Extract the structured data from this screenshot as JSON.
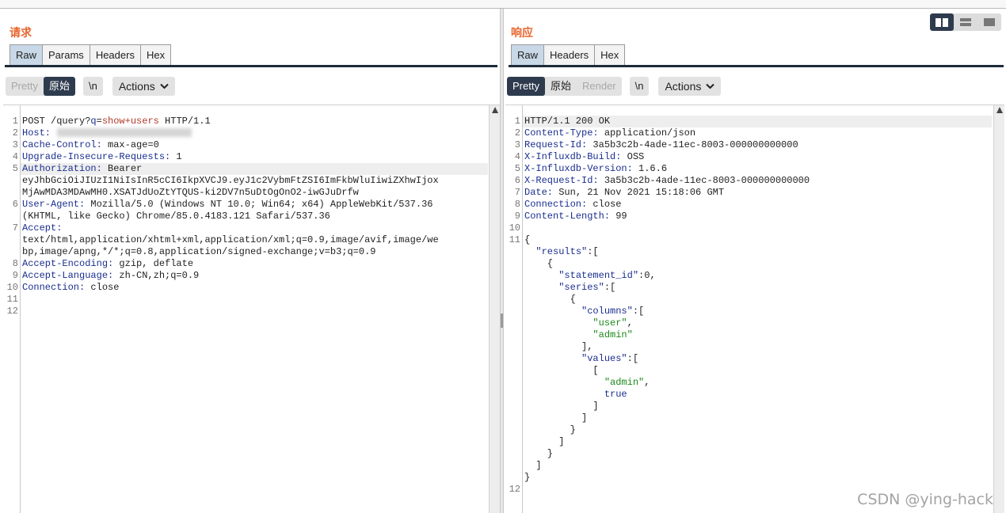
{
  "request": {
    "title": "请求",
    "tabs": [
      "Raw",
      "Params",
      "Headers",
      "Hex"
    ],
    "active_tab": "Raw",
    "toolbar": {
      "pretty": "Pretty",
      "raw": "原始",
      "newline": "\\n",
      "actions": "Actions"
    },
    "lines": [
      {
        "n": "1",
        "parts": [
          {
            "t": "POST /query?",
            "c": "v"
          },
          {
            "t": "q",
            "c": "k"
          },
          {
            "t": "=",
            "c": "v"
          },
          {
            "t": "show+users",
            "c": "q"
          },
          {
            "t": " HTTP/1.1",
            "c": "v"
          }
        ]
      },
      {
        "n": "2",
        "parts": [
          {
            "t": "Host:",
            "c": "k"
          }
        ]
      },
      {
        "n": "3",
        "parts": [
          {
            "t": "Cache-Control:",
            "c": "k"
          },
          {
            "t": " max-age=0",
            "c": "v"
          }
        ]
      },
      {
        "n": "4",
        "parts": [
          {
            "t": "Upgrade-Insecure-Requests:",
            "c": "k"
          },
          {
            "t": " 1",
            "c": "v"
          }
        ]
      },
      {
        "n": "5",
        "parts": [
          {
            "t": "Authorization:",
            "c": "k"
          },
          {
            "t": " Bearer",
            "c": "v"
          }
        ]
      },
      {
        "n": "",
        "parts": [
          {
            "t": "eyJhbGciOiJIUzI1NiIsInR5cCI6IkpXVCJ9.eyJ1c2VybmFtZSI6ImFkbWluIiwiZXhwIjox",
            "c": "v"
          }
        ]
      },
      {
        "n": "",
        "parts": [
          {
            "t": "MjAwMDA3MDAwMH0.XSATJdUoZtYTQUS-ki2DV7n5uDtOgOnO2-iwGJuDrfw",
            "c": "v"
          }
        ]
      },
      {
        "n": "6",
        "parts": [
          {
            "t": "User-Agent:",
            "c": "k"
          },
          {
            "t": " Mozilla/5.0 (Windows NT 10.0; Win64; x64) AppleWebKit/537.36",
            "c": "v"
          }
        ]
      },
      {
        "n": "",
        "parts": [
          {
            "t": "(KHTML, like Gecko) Chrome/85.0.4183.121 Safari/537.36",
            "c": "v"
          }
        ]
      },
      {
        "n": "7",
        "parts": [
          {
            "t": "Accept:",
            "c": "k"
          }
        ]
      },
      {
        "n": "",
        "parts": [
          {
            "t": "text/html,application/xhtml+xml,application/xml;q=0.9,image/avif,image/we",
            "c": "v"
          }
        ]
      },
      {
        "n": "",
        "parts": [
          {
            "t": "bp,image/apng,*/*;q=0.8,application/signed-exchange;v=b3;q=0.9",
            "c": "v"
          }
        ]
      },
      {
        "n": "8",
        "parts": [
          {
            "t": "Accept-Encoding:",
            "c": "k"
          },
          {
            "t": " gzip, deflate",
            "c": "v"
          }
        ]
      },
      {
        "n": "9",
        "parts": [
          {
            "t": "Accept-Language:",
            "c": "k"
          },
          {
            "t": " zh-CN,zh;q=0.9",
            "c": "v"
          }
        ]
      },
      {
        "n": "10",
        "parts": [
          {
            "t": "Connection:",
            "c": "k"
          },
          {
            "t": " close",
            "c": "v"
          }
        ]
      },
      {
        "n": "11",
        "parts": []
      },
      {
        "n": "12",
        "parts": []
      }
    ]
  },
  "response": {
    "title": "响应",
    "tabs": [
      "Raw",
      "Headers",
      "Hex"
    ],
    "active_tab": "Raw",
    "toolbar": {
      "pretty": "Pretty",
      "raw": "原始",
      "render": "Render",
      "newline": "\\n",
      "actions": "Actions"
    },
    "lines": [
      {
        "n": "1",
        "parts": [
          {
            "t": "HTTP/1.1 200 OK",
            "c": "v"
          }
        ]
      },
      {
        "n": "2",
        "parts": [
          {
            "t": "Content-Type:",
            "c": "k"
          },
          {
            "t": " application/json",
            "c": "v"
          }
        ]
      },
      {
        "n": "3",
        "parts": [
          {
            "t": "Request-Id:",
            "c": "k"
          },
          {
            "t": " 3a5b3c2b-4ade-11ec-8003-000000000000",
            "c": "v"
          }
        ]
      },
      {
        "n": "4",
        "parts": [
          {
            "t": "X-Influxdb-Build:",
            "c": "k"
          },
          {
            "t": " OSS",
            "c": "v"
          }
        ]
      },
      {
        "n": "5",
        "parts": [
          {
            "t": "X-Influxdb-Version:",
            "c": "k"
          },
          {
            "t": " 1.6.6",
            "c": "v"
          }
        ]
      },
      {
        "n": "6",
        "parts": [
          {
            "t": "X-Request-Id:",
            "c": "k"
          },
          {
            "t": " 3a5b3c2b-4ade-11ec-8003-000000000000",
            "c": "v"
          }
        ]
      },
      {
        "n": "7",
        "parts": [
          {
            "t": "Date:",
            "c": "k"
          },
          {
            "t": " Sun, 21 Nov 2021 15:18:06 GMT",
            "c": "v"
          }
        ]
      },
      {
        "n": "8",
        "parts": [
          {
            "t": "Connection:",
            "c": "k"
          },
          {
            "t": " close",
            "c": "v"
          }
        ]
      },
      {
        "n": "9",
        "parts": [
          {
            "t": "Content-Length:",
            "c": "k"
          },
          {
            "t": " 99",
            "c": "v"
          }
        ]
      },
      {
        "n": "10",
        "parts": []
      },
      {
        "n": "11",
        "parts": [
          {
            "t": "{",
            "c": "v"
          }
        ]
      },
      {
        "n": "",
        "parts": [
          {
            "t": "  ",
            "c": "v"
          },
          {
            "t": "\"results\"",
            "c": "k"
          },
          {
            "t": ":[",
            "c": "v"
          }
        ]
      },
      {
        "n": "",
        "parts": [
          {
            "t": "    {",
            "c": "v"
          }
        ]
      },
      {
        "n": "",
        "parts": [
          {
            "t": "      ",
            "c": "v"
          },
          {
            "t": "\"statement_id\"",
            "c": "k"
          },
          {
            "t": ":0,",
            "c": "v"
          }
        ]
      },
      {
        "n": "",
        "parts": [
          {
            "t": "      ",
            "c": "v"
          },
          {
            "t": "\"series\"",
            "c": "k"
          },
          {
            "t": ":[",
            "c": "v"
          }
        ]
      },
      {
        "n": "",
        "parts": [
          {
            "t": "        {",
            "c": "v"
          }
        ]
      },
      {
        "n": "",
        "parts": [
          {
            "t": "          ",
            "c": "v"
          },
          {
            "t": "\"columns\"",
            "c": "k"
          },
          {
            "t": ":[",
            "c": "v"
          }
        ]
      },
      {
        "n": "",
        "parts": [
          {
            "t": "            ",
            "c": "v"
          },
          {
            "t": "\"user\"",
            "c": "str"
          },
          {
            "t": ",",
            "c": "v"
          }
        ]
      },
      {
        "n": "",
        "parts": [
          {
            "t": "            ",
            "c": "v"
          },
          {
            "t": "\"admin\"",
            "c": "str"
          }
        ]
      },
      {
        "n": "",
        "parts": [
          {
            "t": "          ],",
            "c": "v"
          }
        ]
      },
      {
        "n": "",
        "parts": [
          {
            "t": "          ",
            "c": "v"
          },
          {
            "t": "\"values\"",
            "c": "k"
          },
          {
            "t": ":[",
            "c": "v"
          }
        ]
      },
      {
        "n": "",
        "parts": [
          {
            "t": "            [",
            "c": "v"
          }
        ]
      },
      {
        "n": "",
        "parts": [
          {
            "t": "              ",
            "c": "v"
          },
          {
            "t": "\"admin\"",
            "c": "str"
          },
          {
            "t": ",",
            "c": "v"
          }
        ]
      },
      {
        "n": "",
        "parts": [
          {
            "t": "              ",
            "c": "v"
          },
          {
            "t": "true",
            "c": "k"
          }
        ]
      },
      {
        "n": "",
        "parts": [
          {
            "t": "            ]",
            "c": "v"
          }
        ]
      },
      {
        "n": "",
        "parts": [
          {
            "t": "          ]",
            "c": "v"
          }
        ]
      },
      {
        "n": "",
        "parts": [
          {
            "t": "        }",
            "c": "v"
          }
        ]
      },
      {
        "n": "",
        "parts": [
          {
            "t": "      ]",
            "c": "v"
          }
        ]
      },
      {
        "n": "",
        "parts": [
          {
            "t": "    }",
            "c": "v"
          }
        ]
      },
      {
        "n": "",
        "parts": [
          {
            "t": "  ]",
            "c": "v"
          }
        ]
      },
      {
        "n": "",
        "parts": [
          {
            "t": "}",
            "c": "v"
          }
        ]
      },
      {
        "n": "12",
        "parts": []
      }
    ]
  },
  "watermark": "CSDN @ying-hack",
  "colors": {
    "accent": "#e8662e",
    "active_button": "#2e3b4e",
    "key": "#1a2e8e",
    "string": "#1b8a1b",
    "param_value": "#b23a2a"
  }
}
